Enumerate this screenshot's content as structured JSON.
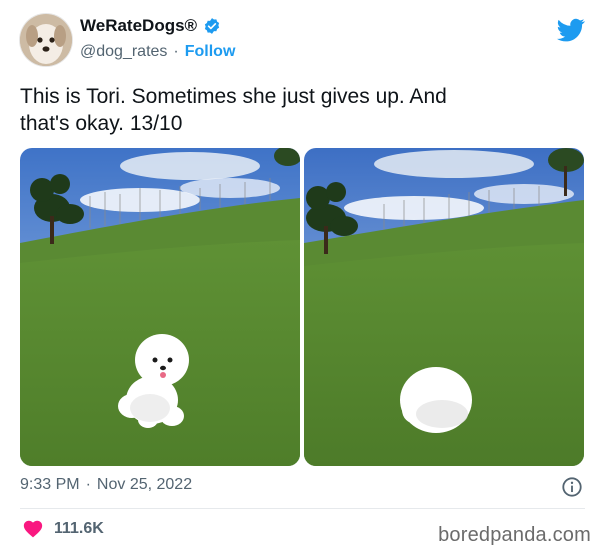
{
  "author": {
    "display_name": "WeRateDogs®",
    "handle": "@dog_rates",
    "separator": "·",
    "follow_label": "Follow"
  },
  "tweet": {
    "text": "This is Tori. Sometimes she just gives up. And\nthat's okay. 13/10"
  },
  "footer": {
    "time": "9:33 PM",
    "separator": "·",
    "date": "Nov 25, 2022",
    "like_count": "111.6K"
  },
  "watermark": "boredpanda.com",
  "colors": {
    "accent": "#1d9bf0",
    "like": "#f91880",
    "muted": "#536471"
  },
  "icons": {
    "verified": "verified-badge-icon",
    "brand": "twitter-bird-icon",
    "info": "info-icon",
    "like": "heart-icon"
  }
}
